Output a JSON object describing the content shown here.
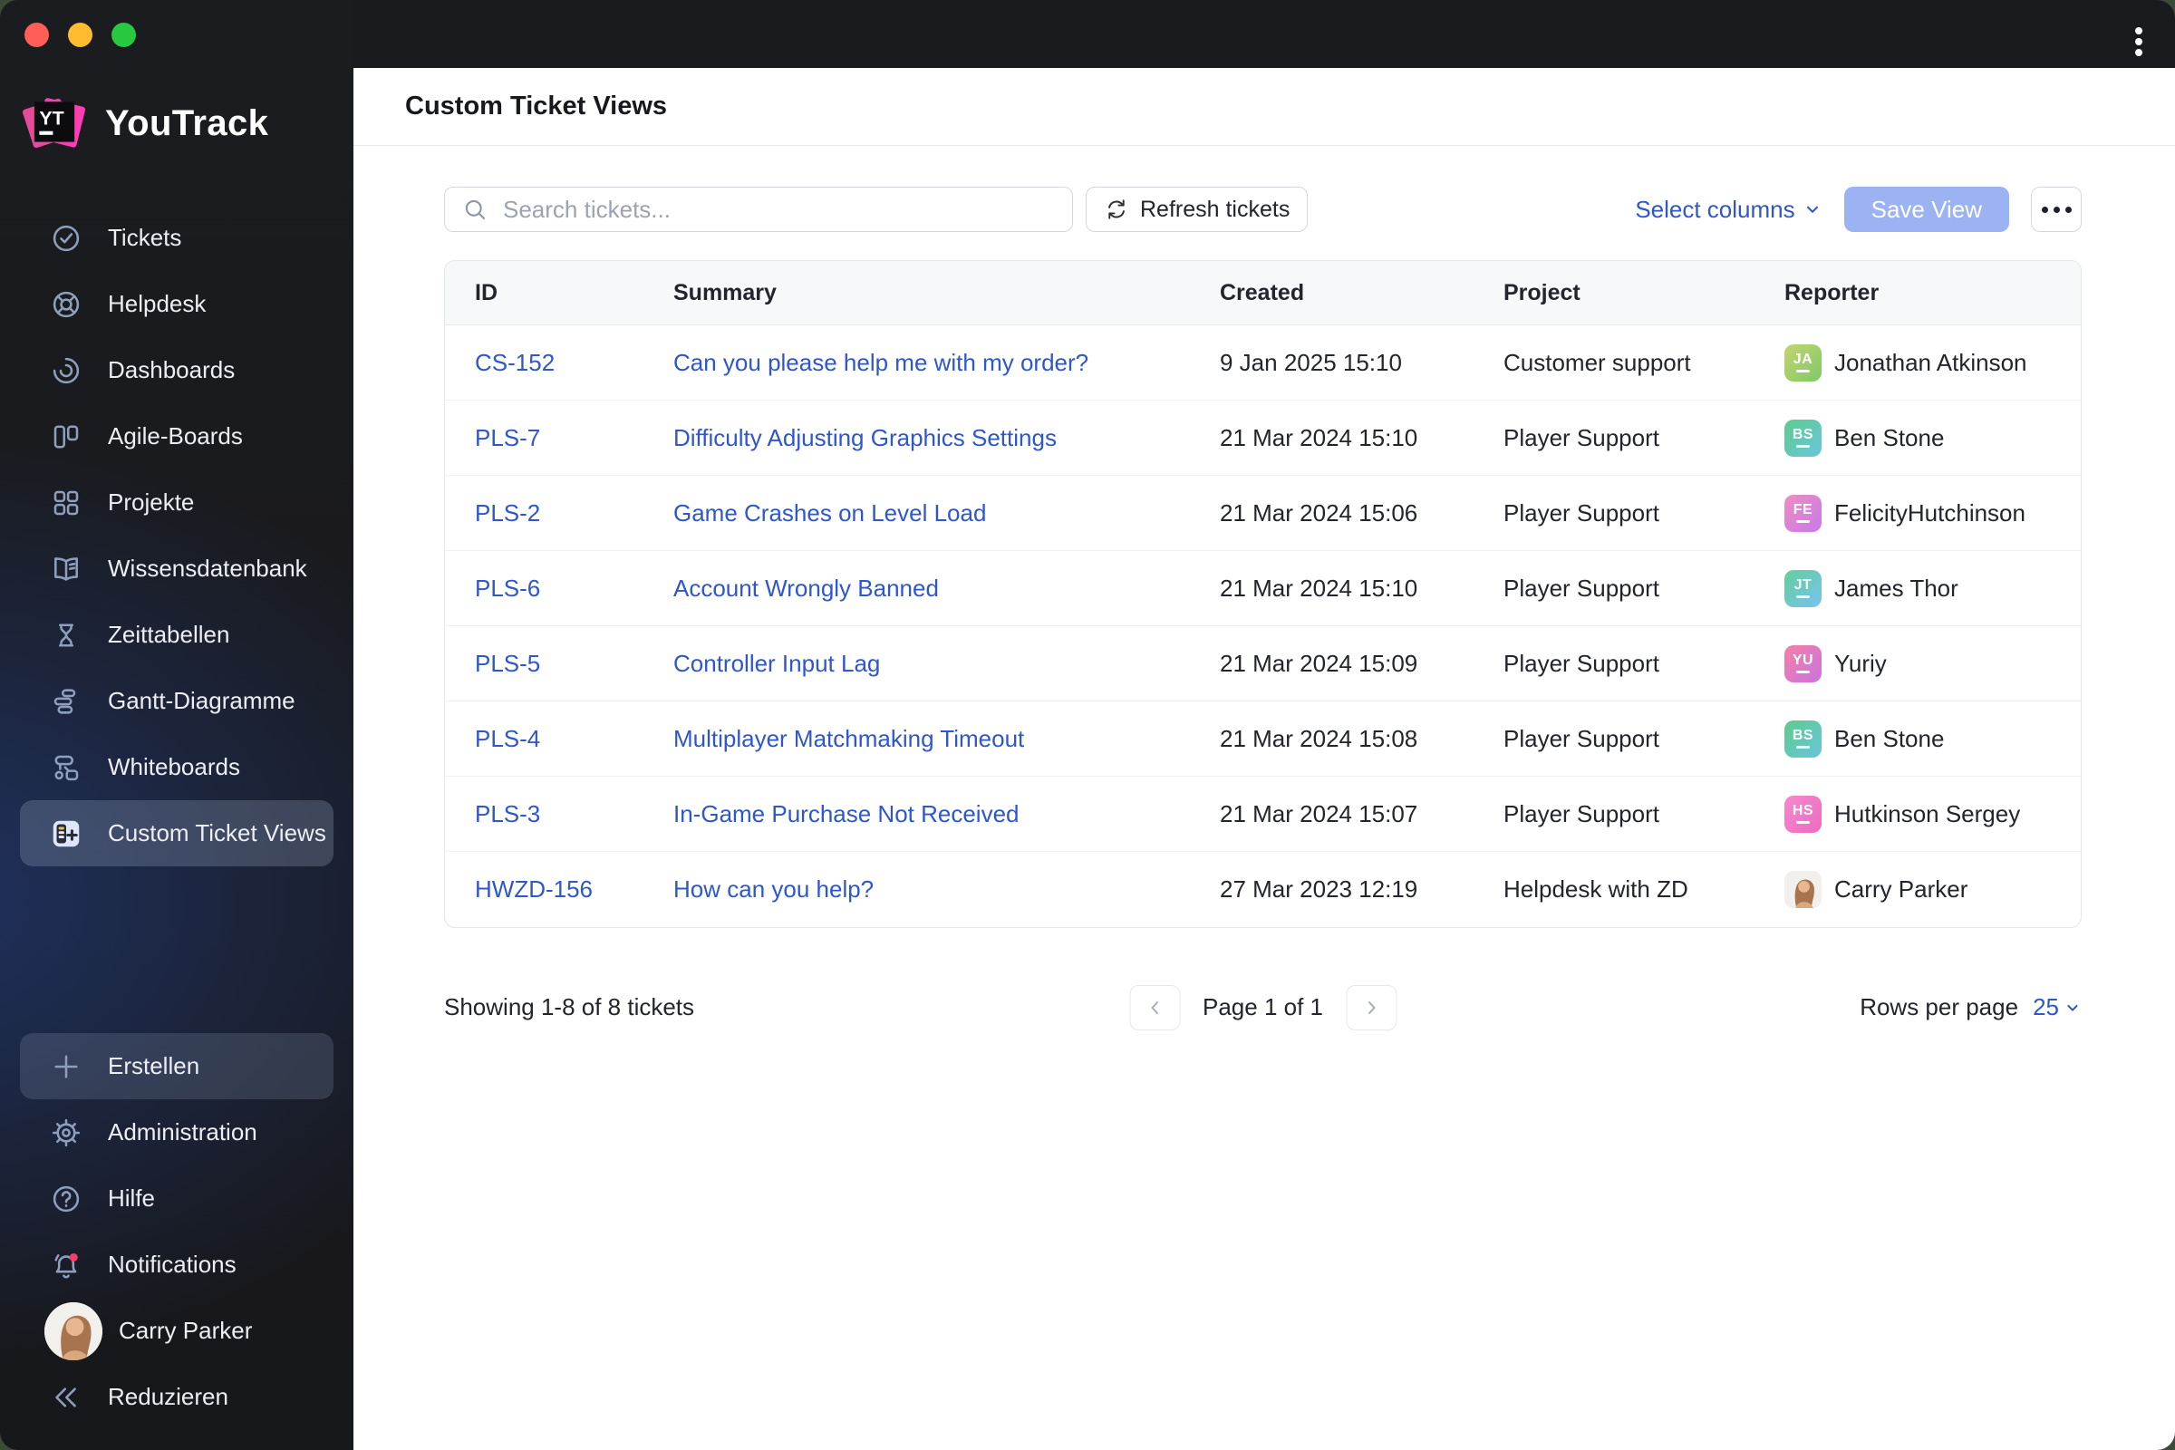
{
  "window": {
    "controls": [
      "close",
      "minimize",
      "maximize"
    ],
    "menu_icon": "kebab-menu"
  },
  "colors": {
    "accent_blue": "#2d56cf",
    "save_view_bg": "#9cb3f3",
    "notification_badge": "#f73b67",
    "sidebar_glow": "#254494"
  },
  "sidebar": {
    "app_name": "YouTrack",
    "items": [
      {
        "icon": "check-circle-icon",
        "label": "Tickets"
      },
      {
        "icon": "lifebuoy-icon",
        "label": "Helpdesk"
      },
      {
        "icon": "gauge-icon",
        "label": "Dashboards"
      },
      {
        "icon": "columns-icon",
        "label": "Agile-Boards"
      },
      {
        "icon": "grid-icon",
        "label": "Projekte"
      },
      {
        "icon": "book-icon",
        "label": "Wissensdatenbank"
      },
      {
        "icon": "hourglass-icon",
        "label": "Zeittabellen"
      },
      {
        "icon": "gantt-icon",
        "label": "Gantt-Diagramme"
      },
      {
        "icon": "whiteboard-icon",
        "label": "Whiteboards"
      },
      {
        "icon": "ticket-views-icon",
        "label": "Custom Ticket Views",
        "active": true
      }
    ],
    "footer_items": [
      {
        "icon": "plus-icon",
        "label": "Erstellen",
        "boxed": true
      },
      {
        "icon": "gear-icon",
        "label": "Administration"
      },
      {
        "icon": "help-icon",
        "label": "Hilfe"
      },
      {
        "icon": "bell-icon",
        "label": "Notifications",
        "unread_badge": true
      },
      {
        "icon": "photo-avatar",
        "label": "Carry Parker",
        "photo": true
      },
      {
        "icon": "collapse-icon",
        "label": "Reduzieren"
      }
    ]
  },
  "header": {
    "title": "Custom Ticket Views"
  },
  "toolbar": {
    "search_placeholder": "Search tickets...",
    "refresh_label": "Refresh tickets",
    "select_columns_label": "Select columns",
    "save_view_label": "Save View",
    "more_actions": "ellipsis-menu"
  },
  "table": {
    "columns": [
      "ID",
      "Summary",
      "Created",
      "Project",
      "Reporter"
    ],
    "rows": [
      {
        "id": "CS-152",
        "summary": "Can you please help me with my order?",
        "created": "9 Jan 2025 15:10",
        "project": "Customer support",
        "reporter": "Jonathan Atkinson",
        "initials": "JA",
        "c1": "#c4d56f",
        "c2": "#7fc868"
      },
      {
        "id": "PLS-7",
        "summary": "Difficulty Adjusting Graphics Settings",
        "created": "21 Mar 2024 15:10",
        "project": "Player Support",
        "reporter": "Ben Stone",
        "initials": "BS",
        "c1": "#5ecb8b",
        "c2": "#68c6dc"
      },
      {
        "id": "PLS-2",
        "summary": "Game Crashes on Level Load",
        "created": "21 Mar 2024 15:06",
        "project": "Player Support",
        "reporter": "FelicityHutchinson",
        "initials": "FE",
        "c1": "#f08cc3",
        "c2": "#c77ae8"
      },
      {
        "id": "PLS-6",
        "summary": "Account Wrongly Banned",
        "created": "21 Mar 2024 15:10",
        "project": "Player Support",
        "reporter": "James Thor",
        "initials": "JT",
        "c1": "#62cf9b",
        "c2": "#78c3ef"
      },
      {
        "id": "PLS-5",
        "summary": "Controller Input Lag",
        "created": "21 Mar 2024 15:09",
        "project": "Player Support",
        "reporter": "Yuriy",
        "initials": "YU",
        "c1": "#f480a5",
        "c2": "#ca74de"
      },
      {
        "id": "PLS-4",
        "summary": "Multiplayer Matchmaking Timeout",
        "created": "21 Mar 2024 15:08",
        "project": "Player Support",
        "reporter": "Ben Stone",
        "initials": "BS",
        "c1": "#5ecb8b",
        "c2": "#68c6dc"
      },
      {
        "id": "PLS-3",
        "summary": "In-Game Purchase Not Received",
        "created": "21 Mar 2024 15:07",
        "project": "Player Support",
        "reporter": "Hutkinson Sergey",
        "initials": "HS",
        "c1": "#f787cc",
        "c2": "#ec6cc0"
      },
      {
        "id": "HWZD-156",
        "summary": "How can you help?",
        "created": "27 Mar 2023 12:19",
        "project": "Helpdesk with ZD",
        "reporter": "Carry Parker",
        "photo": true
      }
    ]
  },
  "pagination": {
    "showing": "Showing 1-8 of 8 tickets",
    "page_indicator": "Page 1 of 1",
    "rows_per_page_label": "Rows per page",
    "rows_per_page_value": "25"
  }
}
